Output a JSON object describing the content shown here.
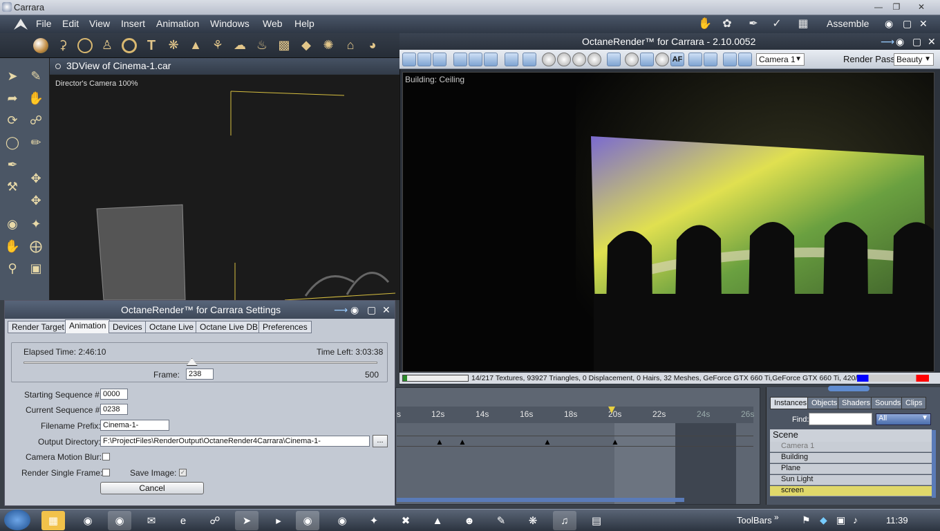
{
  "app": {
    "title": "Carrara",
    "room": "Assemble"
  },
  "menu": [
    "File",
    "Edit",
    "View",
    "Insert",
    "Animation",
    "Windows",
    "Web",
    "Help"
  ],
  "view3d": {
    "title": "3DView of Cinema-1.car",
    "camera_label": "Director's Camera 100%"
  },
  "octane": {
    "title": "OctaneRender™ for Carrara - 2.10.0052",
    "camera": "Camera 1",
    "render_pass_label": "Render Pass",
    "render_pass": "Beauty",
    "overlay_label": "Building: Ceiling",
    "status": "14/217 Textures, 93927 Triangles, 0 Displacement, 0 Hairs, 32 Meshes, GeForce GTX 660 Ti,GeForce GTX 660 Ti, 420/1321/2147 MB"
  },
  "timeline": {
    "ticks": [
      "s",
      "12s",
      "14s",
      "16s",
      "18s",
      "20s",
      "22s",
      "24s",
      "26s"
    ]
  },
  "instances": {
    "tabs": [
      "Instances",
      "Objects",
      "Shaders",
      "Sounds",
      "Clips"
    ],
    "find_label": "Find:",
    "filter": "All",
    "scene_label": "Scene",
    "items": [
      "Camera 1",
      "Building",
      "Plane",
      "Sun Light",
      "screen"
    ]
  },
  "dialog": {
    "title": "OctaneRender™ for Carrara Settings",
    "tabs": [
      "Render Target",
      "Animation",
      "Devices",
      "Octane Live",
      "Octane Live DB",
      "Preferences"
    ],
    "elapsed": "Elapsed Time: 2:46:10",
    "time_left": "Time Left: 3:03:38",
    "frame_label": "Frame:",
    "frame_value": "238",
    "frame_max": "500",
    "frame_progress": 0.476,
    "starting_seq_label": "Starting Sequence #:",
    "starting_seq": "0000",
    "current_seq_label": "Current Sequence #:",
    "current_seq": "0238",
    "prefix_label": "Filename Prefix:",
    "prefix": "Cinema-1-",
    "output_label": "Output Directory:",
    "output": "F:\\ProjectFiles\\RenderOutput\\OctaneRender4Carrara\\Cinema-1-",
    "browse": "...",
    "motion_blur_label": "Camera Motion Blur:",
    "single_frame_label": "Render Single Frame:",
    "save_image_label": "Save Image:",
    "cancel": "Cancel"
  },
  "taskbar": {
    "toolbars": "ToolBars",
    "clock": "11:39"
  }
}
